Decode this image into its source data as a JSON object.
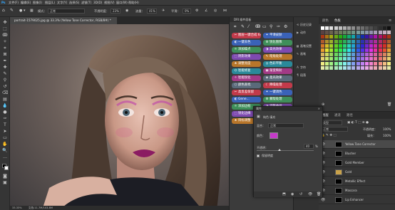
{
  "menu": [
    "文件(F)",
    "编辑(E)",
    "图像(I)",
    "图层(L)",
    "文字(Y)",
    "选择(S)",
    "滤镜(T)",
    "3D(D)",
    "视图(V)",
    "窗口(W)",
    "帮助(H)"
  ],
  "options": {
    "mode_label": "模式：",
    "mode_value": "正常",
    "opacity_label": "不透明度：",
    "opacity_value": "23%",
    "flow_label": "流量：",
    "flow_value": "41%",
    "smooth_label": "平滑：",
    "smooth_value": "0%"
  },
  "document": {
    "tab_title": "portrait-1579025.jpg @ 33.3% (Yellow Tone Corrector, RGB/8#) *",
    "zoom": "33.33%",
    "doc_size": "文档:11.7M/103.8M"
  },
  "dri_panel": {
    "title": "DRI 插件面板",
    "buttons": [
      {
        "label": "图层一键合成 64.5"
      },
      {
        "label": "平滑皮肤"
      },
      {
        "label": "一键去色"
      },
      {
        "label": "锐化图像"
      },
      {
        "label": "添加噪点"
      },
      {
        "label": "高光效果"
      },
      {
        "label": "阴影效果"
      },
      {
        "label": "暗角处理"
      },
      {
        "label": "调整亮度"
      },
      {
        "label": "色彩平衡"
      },
      {
        "label": "智能修复"
      },
      {
        "label": "渐变映射"
      },
      {
        "label": "智能锐化"
      },
      {
        "label": "柔光效果"
      },
      {
        "label": "颜色查找"
      },
      {
        "label": "降噪处理"
      },
      {
        "label": "高反差保留"
      },
      {
        "label": "一键调色"
      },
      {
        "label": "Gene..."
      },
      {
        "label": "蒙版处理"
      },
      {
        "label": "添加边框"
      },
      {
        "label": "调整曲线"
      },
      {
        "label": "锐化边缘"
      },
      {
        "label": "色彩范围"
      },
      {
        "label": "目标调整"
      },
      {
        "label": "输出图像"
      }
    ]
  },
  "side_panel": {
    "items": [
      {
        "label": "历史记录",
        "icon": "history-icon"
      },
      {
        "label": "动作",
        "icon": "actions-icon"
      },
      {
        "label": "画笔设置",
        "icon": "brush-settings-icon"
      },
      {
        "label": "画笔",
        "icon": "brush-icon"
      },
      {
        "label": "字符",
        "icon": "character-icon"
      },
      {
        "label": "段落",
        "icon": "paragraph-icon"
      }
    ]
  },
  "swatch_panel": {
    "tabs": [
      "颜色",
      "色板"
    ],
    "active_tab": "色板"
  },
  "properties": {
    "tab": "属性",
    "title": "纯色 填充",
    "color_label": "颜色：",
    "color_value": "#c63ac9",
    "mode_label": "混合：",
    "mode_value": "正常",
    "opacity_label": "不透明：",
    "opacity_value": "40",
    "opacity_pct": "%",
    "preserve_label": "保留明度"
  },
  "layers_panel": {
    "tabs": [
      "图层",
      "通道",
      "路径"
    ],
    "kind_label": "类型",
    "blend_mode": "正常",
    "opacity_label": "不透明度：",
    "opacity_value": "100%",
    "fill_label": "填充：",
    "fill_value": "100%",
    "layers": [
      {
        "name": "Yellow Tone Corrector",
        "thumb": "#000000"
      },
      {
        "name": "Blusher",
        "thumb": "#000000"
      },
      {
        "name": "Gold Member",
        "thumb": "#000000"
      },
      {
        "name": "Gold",
        "thumb": "#c9a24a"
      },
      {
        "name": "Metallic Effect",
        "thumb": "#000000"
      },
      {
        "name": "Mascara",
        "thumb": "#000000"
      },
      {
        "name": "Lip Enhancer",
        "thumb": "#000000"
      }
    ]
  },
  "accent": "#c63ac9"
}
